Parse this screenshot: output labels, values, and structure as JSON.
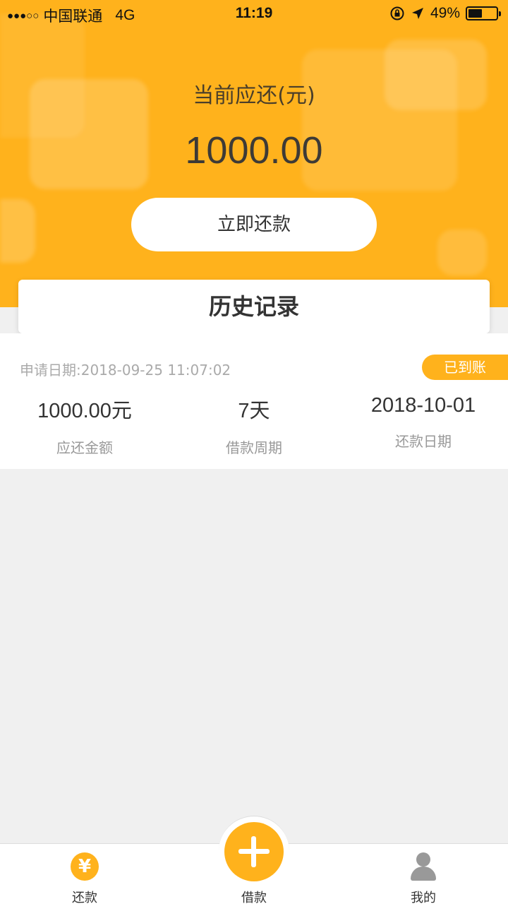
{
  "status_bar": {
    "signal": "●●●○○",
    "carrier": "中国联通",
    "network": "4G",
    "time": "11:19",
    "battery_percent": "49%",
    "battery_level": 0.49,
    "icons": [
      "orientation-lock-icon",
      "location-arrow-icon",
      "battery-icon"
    ]
  },
  "hero": {
    "due_label": "当前应还(元)",
    "due_amount": "1000.00",
    "repay_button": "立即还款",
    "color": "#ffb21c"
  },
  "history": {
    "title": "历史记录",
    "records": [
      {
        "apply_date": "申请日期:2018-09-25 11:07:02",
        "status": "已到账",
        "amount": "1000.00元",
        "amount_label": "应还金额",
        "period": "7天",
        "period_label": "借款周期",
        "repay_date": "2018-10-01",
        "repay_date_label": "还款日期"
      }
    ]
  },
  "tabbar": {
    "tabs": [
      {
        "label": "还款",
        "icon": "yen-icon",
        "icon_glyph": "¥"
      },
      {
        "label": "借款",
        "icon": "plus-icon"
      },
      {
        "label": "我的",
        "icon": "user-icon"
      }
    ]
  }
}
